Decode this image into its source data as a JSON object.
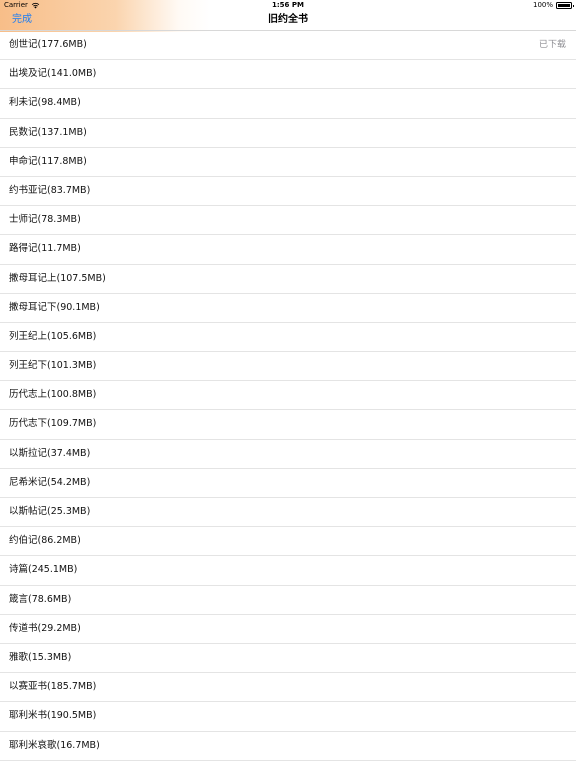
{
  "status_bar": {
    "carrier": "Carrier",
    "time": "1:56 PM",
    "battery": "100%"
  },
  "nav": {
    "done_label": "完成",
    "title": "旧约全书"
  },
  "books": [
    {
      "label": "创世记(177.6MB)",
      "status": "已下载"
    },
    {
      "label": "出埃及记(141.0MB)",
      "status": ""
    },
    {
      "label": "利未记(98.4MB)",
      "status": ""
    },
    {
      "label": "民数记(137.1MB)",
      "status": ""
    },
    {
      "label": "申命记(117.8MB)",
      "status": ""
    },
    {
      "label": "约书亚记(83.7MB)",
      "status": ""
    },
    {
      "label": "士师记(78.3MB)",
      "status": ""
    },
    {
      "label": "路得记(11.7MB)",
      "status": ""
    },
    {
      "label": "撒母耳记上(107.5MB)",
      "status": ""
    },
    {
      "label": "撒母耳记下(90.1MB)",
      "status": ""
    },
    {
      "label": "列王纪上(105.6MB)",
      "status": ""
    },
    {
      "label": "列王纪下(101.3MB)",
      "status": ""
    },
    {
      "label": "历代志上(100.8MB)",
      "status": ""
    },
    {
      "label": "历代志下(109.7MB)",
      "status": ""
    },
    {
      "label": "以斯拉记(37.4MB)",
      "status": ""
    },
    {
      "label": "尼希米记(54.2MB)",
      "status": ""
    },
    {
      "label": "以斯帖记(25.3MB)",
      "status": ""
    },
    {
      "label": "约伯记(86.2MB)",
      "status": ""
    },
    {
      "label": "诗篇(245.1MB)",
      "status": ""
    },
    {
      "label": "箴言(78.6MB)",
      "status": ""
    },
    {
      "label": "传道书(29.2MB)",
      "status": ""
    },
    {
      "label": "雅歌(15.3MB)",
      "status": ""
    },
    {
      "label": "以赛亚书(185.7MB)",
      "status": ""
    },
    {
      "label": "耶利米书(190.5MB)",
      "status": ""
    },
    {
      "label": "耶利米哀歌(16.7MB)",
      "status": ""
    }
  ],
  "colors": {
    "accent": "#1a7cf4",
    "status_text": "#8e8e93",
    "separator": "#e4e4e4",
    "header_glow": "#f7ba82"
  }
}
